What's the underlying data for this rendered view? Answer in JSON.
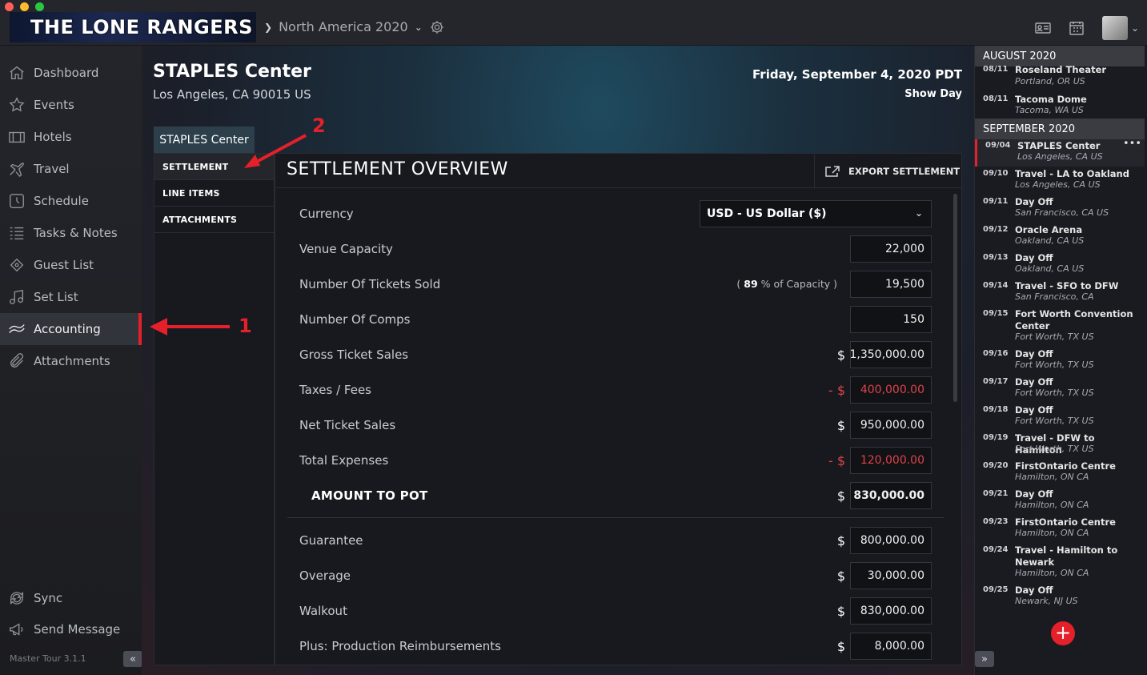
{
  "app": {
    "logo_text": "THE LONE RANGERS",
    "tour": "North America 2020",
    "version": "Master Tour 3.1.1",
    "colors": {
      "accent": "#e5202a",
      "background": "#1a1c21"
    }
  },
  "sidebar": {
    "items": [
      {
        "label": "Dashboard",
        "icon": "home-icon"
      },
      {
        "label": "Events",
        "icon": "star-icon"
      },
      {
        "label": "Hotels",
        "icon": "hotel-icon"
      },
      {
        "label": "Travel",
        "icon": "plane-icon"
      },
      {
        "label": "Schedule",
        "icon": "clock-icon"
      },
      {
        "label": "Tasks & Notes",
        "icon": "list-icon"
      },
      {
        "label": "Guest List",
        "icon": "ticket-icon"
      },
      {
        "label": "Set List",
        "icon": "music-icon"
      },
      {
        "label": "Accounting",
        "icon": "money-icon"
      },
      {
        "label": "Attachments",
        "icon": "paperclip-icon"
      }
    ],
    "bottom": [
      {
        "label": "Sync",
        "icon": "sync-icon"
      },
      {
        "label": "Send Message",
        "icon": "megaphone-icon"
      }
    ],
    "collapse": "«"
  },
  "header": {
    "venue": "STAPLES Center",
    "address": "Los Angeles, CA 90015 US",
    "date": "Friday, September 4, 2020 PDT",
    "day_type": "Show Day"
  },
  "tabs": {
    "venue_tab": "STAPLES Center",
    "subnav": [
      "SETTLEMENT",
      "LINE ITEMS",
      "ATTACHMENTS"
    ]
  },
  "settlement": {
    "title": "SETTLEMENT OVERVIEW",
    "export_label": "EXPORT SETTLEMENT",
    "currency_label": "Currency",
    "currency_value": "USD - US Dollar ($)",
    "capacity_label": "Venue Capacity",
    "capacity": "22,000",
    "tickets_label": "Number Of Tickets Sold",
    "capacity_pct_open": "(",
    "capacity_pct": "89",
    "capacity_pct_suffix": "% of Capacity )",
    "tickets_sold": "19,500",
    "comps_label": "Number Of Comps",
    "comps": "150",
    "gross_label": "Gross Ticket Sales",
    "gross": "1,350,000.00",
    "taxes_label": "Taxes / Fees",
    "taxes": "400,000.00",
    "net_label": "Net Ticket Sales",
    "net": "950,000.00",
    "expenses_label": "Total Expenses",
    "expenses": "120,000.00",
    "pot_label": "AMOUNT TO POT",
    "pot": "830,000.00",
    "guarantee_label": "Guarantee",
    "guarantee": "800,000.00",
    "overage_label": "Overage",
    "overage": "30,000.00",
    "walkout_label": "Walkout",
    "walkout": "830,000.00",
    "reimb_label": "Plus: Production Reimbursements",
    "reimb": "8,000.00",
    "dollar": "$",
    "neg_dollar": "- $"
  },
  "schedule": {
    "months": [
      "AUGUST 2020",
      "SEPTEMBER 2020"
    ],
    "august": [
      {
        "date": "08/11",
        "title": "Roseland Theater",
        "loc": "Portland, OR US"
      },
      {
        "date": "08/11",
        "title": "Tacoma Dome",
        "loc": "Tacoma, WA US"
      }
    ],
    "september": [
      {
        "date": "09/04",
        "title": "STAPLES Center",
        "loc": "Los Angeles, CA US"
      },
      {
        "date": "09/10",
        "title": "Travel - LA to Oakland",
        "loc": "Los Angeles, CA US"
      },
      {
        "date": "09/11",
        "title": "Day Off",
        "loc": "San Francisco, CA US"
      },
      {
        "date": "09/12",
        "title": "Oracle Arena",
        "loc": "Oakland, CA US"
      },
      {
        "date": "09/13",
        "title": "Day Off",
        "loc": "Oakland, CA US"
      },
      {
        "date": "09/14",
        "title": "Travel - SFO to DFW",
        "loc": "San Francisco, CA"
      },
      {
        "date": "09/15",
        "title": "Fort Worth Convention Center",
        "loc": "Fort Worth, TX US"
      },
      {
        "date": "09/16",
        "title": "Day Off",
        "loc": "Fort Worth, TX US"
      },
      {
        "date": "09/17",
        "title": "Day Off",
        "loc": "Fort Worth, TX US"
      },
      {
        "date": "09/18",
        "title": "Day Off",
        "loc": "Fort Worth, TX US"
      },
      {
        "date": "09/19",
        "title": "Travel - DFW to Hamilton",
        "loc": "Fort Worth, TX US"
      },
      {
        "date": "09/20",
        "title": "FirstOntario Centre",
        "loc": "Hamilton, ON CA"
      },
      {
        "date": "09/21",
        "title": "Day Off",
        "loc": "Hamilton, ON CA"
      },
      {
        "date": "09/23",
        "title": "FirstOntario Centre",
        "loc": "Hamilton, ON CA"
      },
      {
        "date": "09/24",
        "title": "Travel - Hamilton to Newark",
        "loc": "Hamilton, ON CA"
      },
      {
        "date": "09/25",
        "title": "Day Off",
        "loc": "Newark, NJ US"
      }
    ],
    "more": "•••",
    "add": "+",
    "expand": "»"
  },
  "annotations": {
    "one": "1",
    "two": "2"
  }
}
